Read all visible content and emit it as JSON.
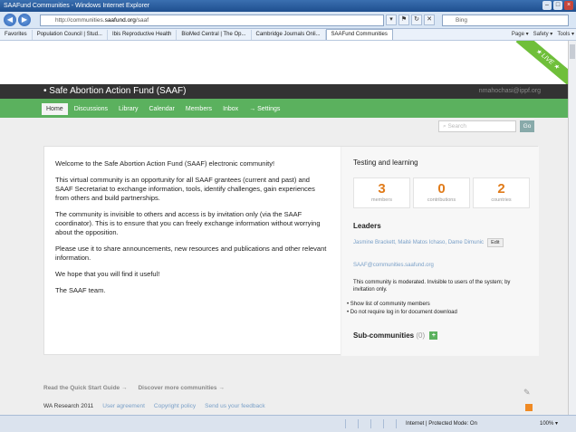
{
  "window": {
    "title": "SAAFund Communities - Windows Internet Explorer"
  },
  "browser": {
    "url_prefix": "http://communities.",
    "url_domain": "saafund.org",
    "url_path": "/saaf",
    "search_placeholder": "Bing",
    "favorites_label": "Favorites",
    "tabs": [
      "Population Council | Stud...",
      "Ibis Reproductive Health",
      "BioMed Central | The Op...",
      "Cambridge Journals Onli...",
      "SAAFund Communities"
    ],
    "tools": [
      "Page ▾",
      "Safety ▾",
      "Tools ▾"
    ]
  },
  "community": {
    "name": "• Safe Abortion Action Fund (SAAF)",
    "user_email": "nmahochasi@ippf.org",
    "live_label": "LIVE"
  },
  "nav": {
    "tabs": [
      "Home",
      "Discussions",
      "Library",
      "Calendar",
      "Members",
      "Inbox",
      "→ Settings"
    ]
  },
  "search": {
    "placeholder": "Search",
    "go_label": "Go"
  },
  "welcome": {
    "paragraphs": [
      "Welcome to the Safe Abortion Action Fund (SAAF) electronic community!",
      "This virtual community is an opportunity for all SAAF grantees (current and past) and SAAF Secretariat to exchange information, tools, identify challenges, gain experiences from others and build partnerships.",
      "The community is invisible to others and access is by invitation only (via the SAAF coordinator). This is to ensure that you can freely exchange information without worrying about the opposition.",
      "Please use it to share announcements, new resources and publications and other relevant information.",
      "We hope that you will find it useful!",
      "The SAAF team."
    ]
  },
  "sidebar": {
    "title": "Testing and learning",
    "stats": [
      {
        "num": "3",
        "label": "members"
      },
      {
        "num": "0",
        "label": "contributions"
      },
      {
        "num": "2",
        "label": "countries"
      }
    ],
    "leaders_heading": "Leaders",
    "leaders": "Jasmine Brackett, Maité Matos Ichaso, Dame Dimunic",
    "edit_label": "Edit",
    "email": "SAAF@communities.saafund.org",
    "moderated": "This community is moderated. Invisible to users of the system; by invitation only.",
    "bullets": [
      "Show list of community members",
      "Do not require log in for document download"
    ],
    "subcommunities_label": "Sub-communities",
    "subcommunities_count": "(0)"
  },
  "footer": {
    "quick_start": "Read the Quick Start Guide →",
    "discover": "Discover more communities →",
    "copyright": "WA Research 2011",
    "links": [
      "User agreement",
      "Copyright policy",
      "Send us your feedback"
    ]
  },
  "status": {
    "zone": "Internet | Protected Mode: On",
    "zoom": "100% ▾"
  }
}
